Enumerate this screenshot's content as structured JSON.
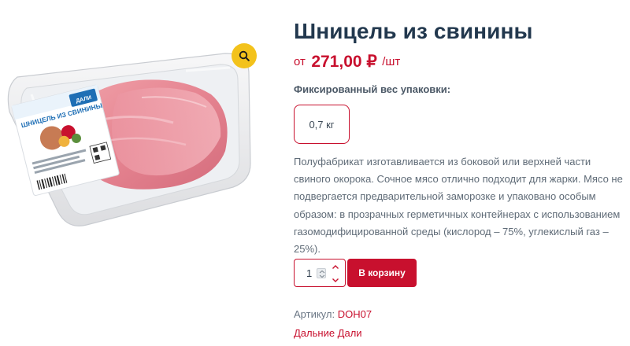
{
  "product": {
    "title": "Шницель из свинины",
    "price": {
      "prefix": "от",
      "amount": "271,00 ₽",
      "unit": "/шт"
    },
    "weight": {
      "label": "Фиксированный вес упаковки:",
      "options": [
        "0,7 кг"
      ],
      "selected": "0,7 кг"
    },
    "description": "Полуфабрикат изготавливается из боковой или верхней части свиного окорока. Сочное мясо отлично подходит для жарки. Мясо не подвергается предварительной заморозке и упаковано особым образом: в прозрачных герметичных контейнерах с использованием газомодифицированной среды (кислород – 75%, углекислый газ – 25%).",
    "quantity": "1",
    "add_to_cart_label": "В корзину",
    "sku": {
      "label": "Артикул:",
      "value": "DOH07"
    },
    "brand": "Дальние Дали"
  },
  "image": {
    "package_label_text": "ШНИЦЕЛЬ ИЗ СВИНИНЫ",
    "logo_text": "ДАЛИ",
    "zoom_icon": "search-icon"
  },
  "colors": {
    "accent": "#c8102e",
    "title": "#22384e",
    "zoom_button": "#f3c21b",
    "label_blue": "#1f6fb5"
  }
}
